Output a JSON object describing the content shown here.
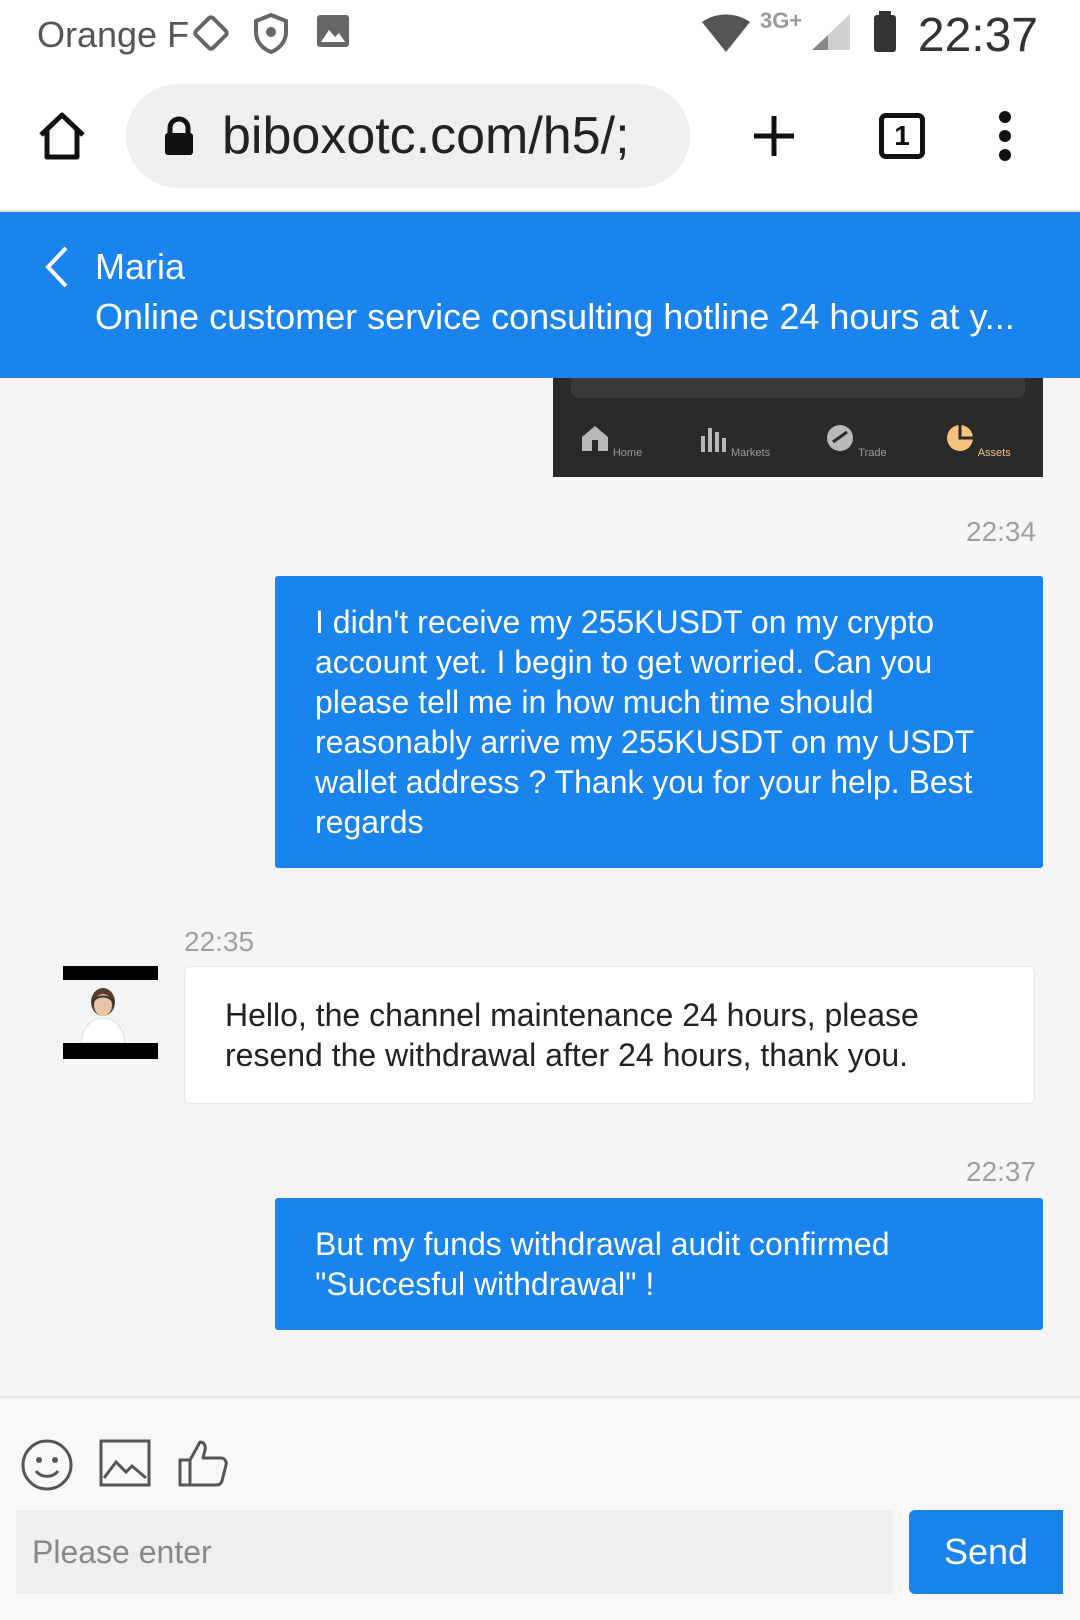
{
  "status_bar": {
    "carrier": "Orange F",
    "network": "3G+",
    "time": "22:37"
  },
  "browser": {
    "url": "biboxotc.com/h5/;",
    "tab_count": "1",
    "icons": [
      "home-icon",
      "lock-icon",
      "plus-icon",
      "tabs-icon",
      "more-vert-icon"
    ]
  },
  "chat_header": {
    "agent_name": "Maria",
    "subtitle": "Online customer service consulting hotline 24 hours at y..."
  },
  "shared_image": {
    "tabs": [
      {
        "label": "Home",
        "icon": "home-icon"
      },
      {
        "label": "Markets",
        "icon": "bar-chart-icon"
      },
      {
        "label": "Trade",
        "icon": "trade-icon"
      },
      {
        "label": "Assets",
        "icon": "pie-chart-icon",
        "color": "#f5c27a"
      }
    ]
  },
  "messages": [
    {
      "direction": "outgoing",
      "time": "22:34",
      "text": "I didn't receive my 255KUSDT on my crypto account yet. I begin to get worried. Can you please tell me in how much time should reasonably arrive my 255KUSDT on my USDT wallet address ? Thank you for your help. Best regards"
    },
    {
      "direction": "incoming",
      "time": "22:35",
      "text": "Hello, the channel maintenance 24 hours, please resend the withdrawal after 24 hours, thank you."
    },
    {
      "direction": "outgoing",
      "time": "22:37",
      "text": "But my funds withdrawal audit confirmed \"Succesful withdrawal\" !"
    }
  ],
  "input_bar": {
    "placeholder": "Please enter",
    "send_label": "Send",
    "tools": [
      "smiley-icon",
      "image-icon",
      "thumbs-up-icon"
    ]
  },
  "colors": {
    "accent": "#1983ee",
    "outgoing_bubble": "#1983ee",
    "incoming_bubble": "#ffffff",
    "background": "#f5f5f7"
  }
}
